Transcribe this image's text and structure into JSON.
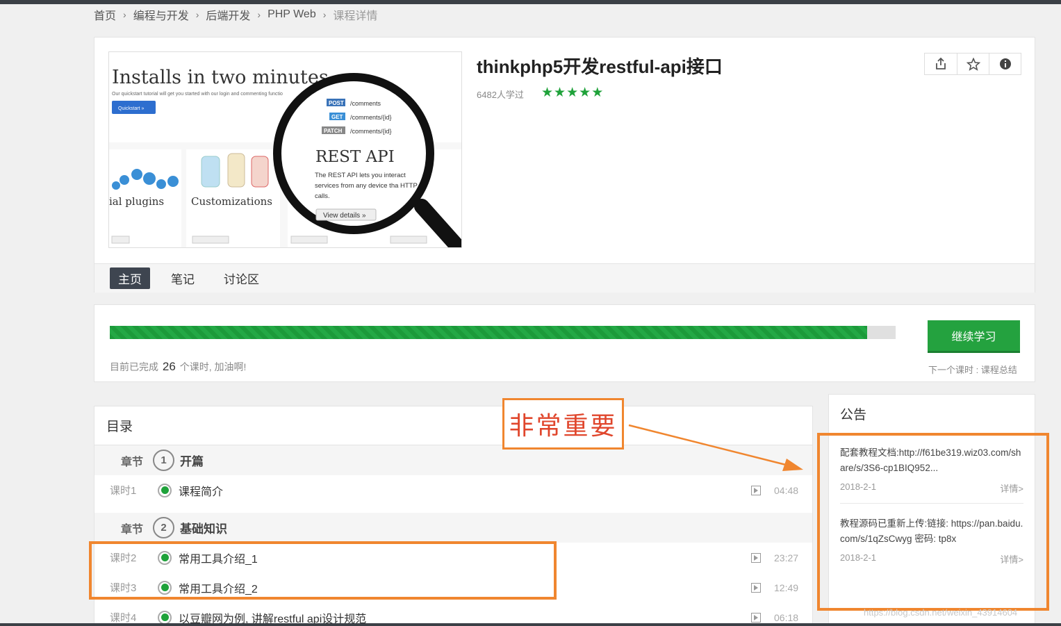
{
  "breadcrumb": {
    "items": [
      "首页",
      "编程与开发",
      "后端开发",
      "PHP Web"
    ],
    "current": "课程详情"
  },
  "course": {
    "title": "thinkphp5开发restful-api接口",
    "learners": "6482人学过",
    "rating_stars": 5,
    "thumbnail": {
      "headline": "Installs in two minutes.",
      "subtext": "Our quickstart tutorial will get you started with our login and commenting functio",
      "quickstart_btn": "Quickstart »",
      "methods": [
        "POST",
        "GET",
        "PATCH"
      ],
      "endpoints": [
        "/comments",
        "/comments/{id}",
        "/comments/{id}"
      ],
      "magnifier_title": "REST API",
      "magnifier_text": "The REST API lets you interact services from any device tha HTTP calls.",
      "view_details": "View details »",
      "cards": [
        "ial plugins",
        "Customizations"
      ]
    }
  },
  "tabs": [
    {
      "label": "主页",
      "active": true
    },
    {
      "label": "笔记",
      "active": false
    },
    {
      "label": "讨论区",
      "active": false
    }
  ],
  "progress": {
    "fraction": 0.964,
    "prefix": "目前已完成",
    "count": "26",
    "suffix": "个课时, 加油啊!",
    "continue_label": "继续学习",
    "next_lesson": "下一个课时 : 课程总结"
  },
  "catalog": {
    "title": "目录",
    "chapter_label": "章节",
    "chapters": [
      {
        "num": "1",
        "title": "开篇",
        "lessons": [
          {
            "label": "课时1",
            "title": "课程简介",
            "time": "04:48"
          }
        ]
      },
      {
        "num": "2",
        "title": "基础知识",
        "lessons": [
          {
            "label": "课时2",
            "title": "常用工具介绍_1",
            "time": "23:27"
          },
          {
            "label": "课时3",
            "title": "常用工具介绍_2",
            "time": "12:49"
          },
          {
            "label": "课时4",
            "title": "以豆瓣网为例, 讲解restful api设计规范",
            "time": "06:18"
          }
        ]
      }
    ]
  },
  "notice": {
    "title": "公告",
    "items": [
      {
        "text": "配套教程文档:http://f61be319.wiz03.com/share/s/3S6-cp1BIQ952...",
        "date": "2018-2-1",
        "more": "详情>"
      },
      {
        "text": "教程源码已重新上传:链接: https://pan.baidu.com/s/1qZsCwyg 密码: tp8x",
        "date": "2018-2-1",
        "more": "详情>"
      }
    ]
  },
  "annotation": {
    "label": "非常重要",
    "color": "#f0862f"
  },
  "watermark": "https://blog.csdn.net/weixin_43914604",
  "colors": {
    "accent_green": "#24a23f",
    "tab_active_bg": "#3e4550",
    "annotation_orange": "#f0862f"
  }
}
